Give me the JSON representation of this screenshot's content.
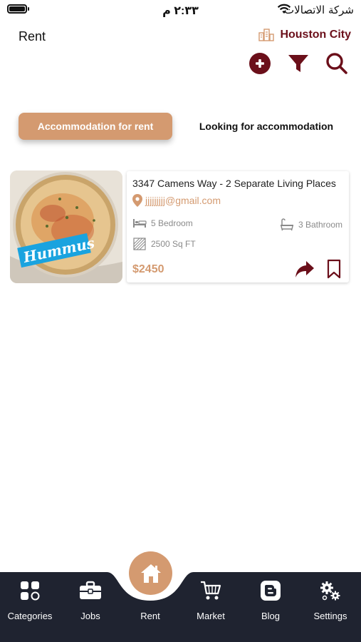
{
  "status_bar": {
    "time": "٢:٣٣ م",
    "carrier": "شركة الاتصالات"
  },
  "header": {
    "title": "Rent",
    "city": "Houston City"
  },
  "icons": {
    "add": "plus-circle-icon",
    "filter": "funnel-icon",
    "search": "magnifier-icon"
  },
  "tabs": [
    {
      "label": "Accommodation for rent",
      "active": true
    },
    {
      "label": "Looking for accommodation",
      "active": false
    }
  ],
  "listings": [
    {
      "photo_badge": "Hummus",
      "title": "3347 Camens Way - 2 Separate Living Places",
      "email": "jjjjjjjjj@gmail.com",
      "bedrooms": "5 Bedroom",
      "bathrooms": "3 Bathroom",
      "area": "2500 Sq FT",
      "price": "$2450"
    }
  ],
  "bottom_nav": {
    "items": [
      {
        "label": "Categories",
        "icon": "grid-icon"
      },
      {
        "label": "Jobs",
        "icon": "briefcase-icon"
      },
      {
        "label": "Rent",
        "icon": "home-icon",
        "active": true
      },
      {
        "label": "Market",
        "icon": "cart-icon"
      },
      {
        "label": "Blog",
        "icon": "blogger-icon"
      },
      {
        "label": "Settings",
        "icon": "gears-icon"
      }
    ]
  },
  "colors": {
    "accent": "#d49a70",
    "brand_dark": "#6b0f1a",
    "nav_background": "#1f2330"
  }
}
